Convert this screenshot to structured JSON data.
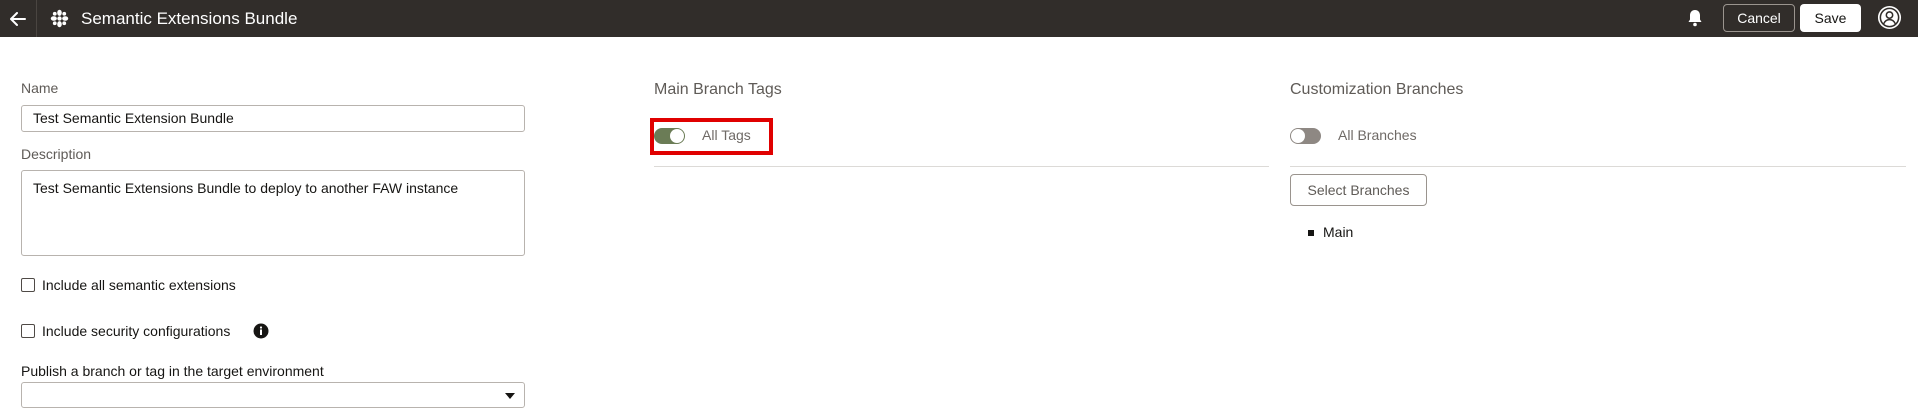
{
  "header": {
    "title": "Semantic Extensions Bundle",
    "cancel_label": "Cancel",
    "save_label": "Save",
    "icons": [
      "back-arrow-icon",
      "bundle-icon",
      "bell-icon",
      "user-icon"
    ]
  },
  "form": {
    "name_label": "Name",
    "name_value": "Test Semantic Extension Bundle",
    "description_label": "Description",
    "description_value": "Test Semantic Extensions Bundle to deploy to another FAW instance",
    "include_all_label": "Include all semantic extensions",
    "include_all_checked": false,
    "include_security_label": "Include security configurations",
    "include_security_checked": false,
    "publish_label": "Publish a branch or tag in the target environment",
    "publish_value": ""
  },
  "main_branch_tags": {
    "title": "Main Branch Tags",
    "toggle_label": "All Tags",
    "toggle_on": true
  },
  "customization_branches": {
    "title": "Customization Branches",
    "toggle_label": "All Branches",
    "toggle_on": false,
    "select_button_label": "Select Branches",
    "branches": [
      "Main"
    ]
  },
  "colors": {
    "topbar": "#312d2a",
    "toggle_on": "#6b7c56",
    "toggle_off": "#8e8883",
    "highlight": "#e00000"
  }
}
